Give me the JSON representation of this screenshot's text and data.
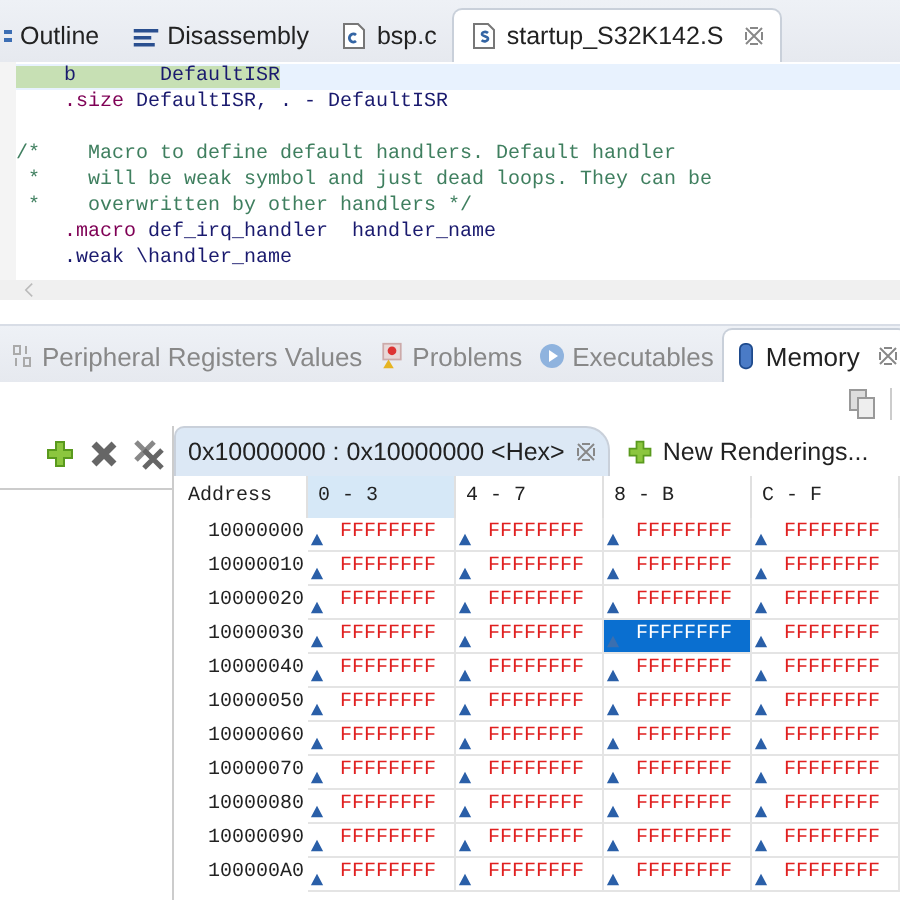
{
  "editor_tabs": [
    {
      "label": "Outline",
      "kind": "outline",
      "selected": false
    },
    {
      "label": "Disassembly",
      "kind": "disasm",
      "selected": false
    },
    {
      "label": "bsp.c",
      "kind": "cfile",
      "selected": false
    },
    {
      "label": "startup_S32K142.S",
      "kind": "sfile",
      "selected": true
    }
  ],
  "code_lines": [
    {
      "highlighted": true,
      "segments": [
        {
          "kind": "plain",
          "text": "    b       DefaultISR"
        }
      ]
    },
    {
      "highlighted": false,
      "segments": [
        {
          "kind": "directive",
          "text": "    .size"
        },
        {
          "kind": "plain",
          "text": " DefaultISR, . - DefaultISR"
        }
      ]
    },
    {
      "highlighted": false
    },
    {
      "highlighted": false,
      "segments": [
        {
          "kind": "comment",
          "text": "/*    Macro to define default handlers. Default handler"
        }
      ]
    },
    {
      "highlighted": false,
      "segments": [
        {
          "kind": "comment",
          "text": " *    will be weak symbol and just dead loops. They can be"
        }
      ]
    },
    {
      "highlighted": false,
      "segments": [
        {
          "kind": "comment",
          "text": " *    overwritten by other handlers */"
        }
      ]
    },
    {
      "highlighted": false,
      "segments": [
        {
          "kind": "directive",
          "text": "    .macro"
        },
        {
          "kind": "plain",
          "text": " def_irq_handler  handler_name"
        }
      ]
    },
    {
      "highlighted": false,
      "segments": [
        {
          "kind": "plain",
          "text": "    .weak \\handler_name"
        }
      ]
    }
  ],
  "view_tabs": [
    {
      "label": "Peripheral Registers Values",
      "kind": "registers",
      "selected": false
    },
    {
      "label": "Problems",
      "kind": "problems",
      "selected": false
    },
    {
      "label": "Executables",
      "kind": "executables",
      "selected": false
    },
    {
      "label": "Memory",
      "kind": "memory",
      "selected": true
    }
  ],
  "rendering_tab": {
    "label": "0x10000000 : 0x10000000 <Hex>",
    "selected": true
  },
  "new_renderings": {
    "label": "New Renderings..."
  },
  "table": {
    "address_header": "Address",
    "columns": [
      {
        "label": "0 - 3",
        "selected": true
      },
      {
        "label": "4 - 7",
        "selected": false
      },
      {
        "label": "8 - B",
        "selected": false
      },
      {
        "label": "C - F",
        "selected": false
      }
    ],
    "rows": [
      {
        "address": "10000000",
        "cells": [
          {
            "value": "FFFFFFFF",
            "selected": false
          },
          {
            "value": "FFFFFFFF",
            "selected": false
          },
          {
            "value": "FFFFFFFF",
            "selected": false
          },
          {
            "value": "FFFFFFFF",
            "selected": false
          }
        ]
      },
      {
        "address": "10000010",
        "cells": [
          {
            "value": "FFFFFFFF",
            "selected": false
          },
          {
            "value": "FFFFFFFF",
            "selected": false
          },
          {
            "value": "FFFFFFFF",
            "selected": false
          },
          {
            "value": "FFFFFFFF",
            "selected": false
          }
        ]
      },
      {
        "address": "10000020",
        "cells": [
          {
            "value": "FFFFFFFF",
            "selected": false
          },
          {
            "value": "FFFFFFFF",
            "selected": false
          },
          {
            "value": "FFFFFFFF",
            "selected": false
          },
          {
            "value": "FFFFFFFF",
            "selected": false
          }
        ]
      },
      {
        "address": "10000030",
        "cells": [
          {
            "value": "FFFFFFFF",
            "selected": false
          },
          {
            "value": "FFFFFFFF",
            "selected": false
          },
          {
            "value": "FFFFFFFF",
            "selected": true
          },
          {
            "value": "FFFFFFFF",
            "selected": false
          }
        ]
      },
      {
        "address": "10000040",
        "cells": [
          {
            "value": "FFFFFFFF",
            "selected": false
          },
          {
            "value": "FFFFFFFF",
            "selected": false
          },
          {
            "value": "FFFFFFFF",
            "selected": false
          },
          {
            "value": "FFFFFFFF",
            "selected": false
          }
        ]
      },
      {
        "address": "10000050",
        "cells": [
          {
            "value": "FFFFFFFF",
            "selected": false
          },
          {
            "value": "FFFFFFFF",
            "selected": false
          },
          {
            "value": "FFFFFFFF",
            "selected": false
          },
          {
            "value": "FFFFFFFF",
            "selected": false
          }
        ]
      },
      {
        "address": "10000060",
        "cells": [
          {
            "value": "FFFFFFFF",
            "selected": false
          },
          {
            "value": "FFFFFFFF",
            "selected": false
          },
          {
            "value": "FFFFFFFF",
            "selected": false
          },
          {
            "value": "FFFFFFFF",
            "selected": false
          }
        ]
      },
      {
        "address": "10000070",
        "cells": [
          {
            "value": "FFFFFFFF",
            "selected": false
          },
          {
            "value": "FFFFFFFF",
            "selected": false
          },
          {
            "value": "FFFFFFFF",
            "selected": false
          },
          {
            "value": "FFFFFFFF",
            "selected": false
          }
        ]
      },
      {
        "address": "10000080",
        "cells": [
          {
            "value": "FFFFFFFF",
            "selected": false
          },
          {
            "value": "FFFFFFFF",
            "selected": false
          },
          {
            "value": "FFFFFFFF",
            "selected": false
          },
          {
            "value": "FFFFFFFF",
            "selected": false
          }
        ]
      },
      {
        "address": "10000090",
        "cells": [
          {
            "value": "FFFFFFFF",
            "selected": false
          },
          {
            "value": "FFFFFFFF",
            "selected": false
          },
          {
            "value": "FFFFFFFF",
            "selected": false
          },
          {
            "value": "FFFFFFFF",
            "selected": false
          }
        ]
      },
      {
        "address": "100000A0",
        "cells": [
          {
            "value": "FFFFFFFF",
            "selected": false
          },
          {
            "value": "FFFFFFFF",
            "selected": false
          },
          {
            "value": "FFFFFFFF",
            "selected": false
          },
          {
            "value": "FFFFFFFF",
            "selected": false
          }
        ]
      }
    ]
  }
}
